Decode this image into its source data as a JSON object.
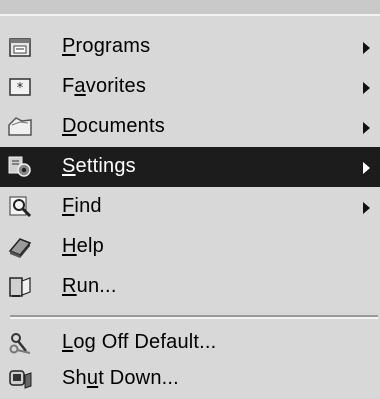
{
  "menu": {
    "items": [
      {
        "name": "programs",
        "pre": "",
        "ul": "P",
        "post": "rograms",
        "submenu": true,
        "active": false,
        "icon": "programs-folder-icon"
      },
      {
        "name": "favorites",
        "pre": "F",
        "ul": "a",
        "post": "vorites",
        "submenu": true,
        "active": false,
        "icon": "favorites-star-icon"
      },
      {
        "name": "documents",
        "pre": "",
        "ul": "D",
        "post": "ocuments",
        "submenu": true,
        "active": false,
        "icon": "documents-folder-icon"
      },
      {
        "name": "settings",
        "pre": "",
        "ul": "S",
        "post": "ettings",
        "submenu": true,
        "active": true,
        "icon": "settings-icon"
      },
      {
        "name": "find",
        "pre": "",
        "ul": "F",
        "post": "ind",
        "submenu": true,
        "active": false,
        "icon": "find-magnifier-icon"
      },
      {
        "name": "help",
        "pre": "",
        "ul": "H",
        "post": "elp",
        "submenu": false,
        "active": false,
        "icon": "help-book-icon"
      },
      {
        "name": "run",
        "pre": "",
        "ul": "R",
        "post": "un...",
        "submenu": false,
        "active": false,
        "icon": "run-icon"
      },
      {
        "name": "log-off",
        "pre": "",
        "ul": "L",
        "post": "og Off Default...",
        "submenu": false,
        "active": false,
        "icon": "log-off-keys-icon"
      },
      {
        "name": "shut-down",
        "pre": "Sh",
        "ul": "u",
        "post": "t Down...",
        "submenu": false,
        "active": false,
        "icon": "shut-down-computer-icon"
      }
    ]
  },
  "colors": {
    "menu_bg": "#d8d8d8",
    "highlight_bg": "#1c1c1c",
    "highlight_text": "#ffffff",
    "text": "#000000"
  }
}
